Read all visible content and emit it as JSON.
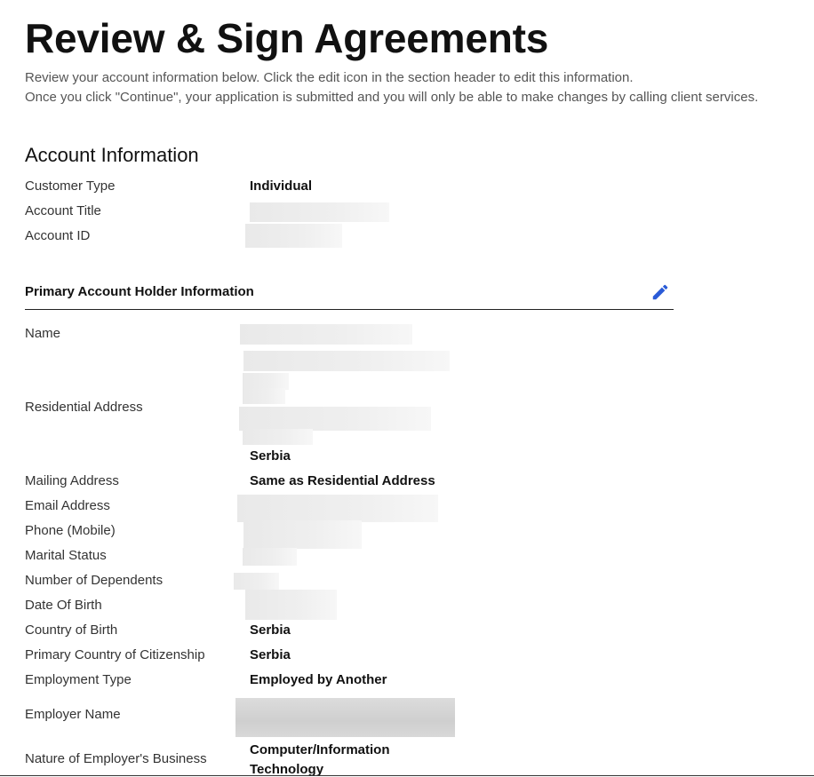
{
  "header": {
    "title": "Review & Sign Agreements",
    "intro_line_1": "Review your account information below. Click the edit icon in the section header to edit this information.",
    "intro_line_2": "Once you click \"Continue\", your application is submitted and you will only be able to make changes by calling client services."
  },
  "account_information": {
    "heading": "Account Information",
    "rows": [
      {
        "label": "Customer Type",
        "value": "Individual"
      },
      {
        "label": "Account Title",
        "value": ""
      },
      {
        "label": "Account ID",
        "value": ""
      }
    ]
  },
  "primary_holder": {
    "title": "Primary Account Holder Information",
    "edit_icon": "pencil-icon",
    "accent_color": "#2a5bd7",
    "rows": {
      "name": {
        "label": "Name"
      },
      "residential_address": {
        "label": "Residential Address",
        "country": "Serbia"
      },
      "mailing_address": {
        "label": "Mailing Address",
        "value": "Same as Residential Address"
      },
      "email_address": {
        "label": "Email Address"
      },
      "phone_mobile": {
        "label": "Phone (Mobile)"
      },
      "marital_status": {
        "label": "Marital Status"
      },
      "number_of_dependents": {
        "label": "Number of Dependents"
      },
      "date_of_birth": {
        "label": "Date Of Birth"
      },
      "country_of_birth": {
        "label": "Country of Birth",
        "value": "Serbia"
      },
      "primary_citizenship": {
        "label": "Primary Country of Citizenship",
        "value": "Serbia"
      },
      "employment_type": {
        "label": "Employment Type",
        "value": "Employed by Another"
      },
      "employer_name": {
        "label": "Employer Name"
      },
      "nature_of_business": {
        "label": "Nature of Employer's Business",
        "value_line_1": "Computer/Information",
        "value_line_2": "Technology"
      }
    }
  }
}
